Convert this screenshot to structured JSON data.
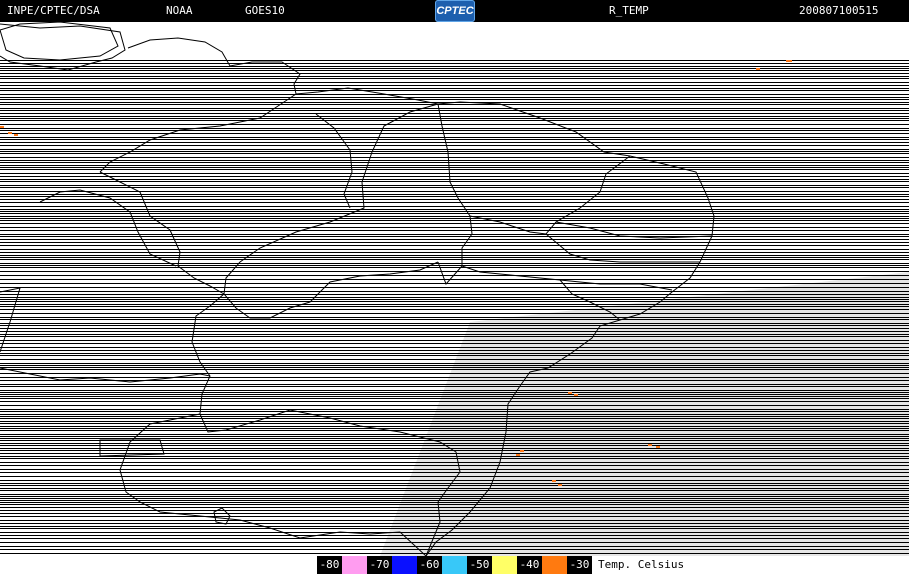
{
  "header": {
    "source": "INPE/CPTEC/DSA",
    "agency": "NOAA",
    "satellite": "GOES10",
    "product": "R_TEMP",
    "timestamp": "200807100515",
    "logo_text": "CPTEC"
  },
  "map": {
    "background_color": "#ffffff",
    "scanline_color": "#000000",
    "border_color": "#000000",
    "haze_color": "#e6e6e6",
    "cold_pixel_color": "#ff7a1a"
  },
  "legend": {
    "title": "Temp. Celsius",
    "items": [
      {
        "label": "-80",
        "color": "#ff9cf0"
      },
      {
        "label": "-70",
        "color": "#0a10ff"
      },
      {
        "label": "-60",
        "color": "#38c8f8"
      },
      {
        "label": "-50",
        "color": "#ffff66"
      },
      {
        "label": "-40",
        "color": "#ff7a10"
      },
      {
        "label": "-30",
        "color": ""
      }
    ]
  }
}
